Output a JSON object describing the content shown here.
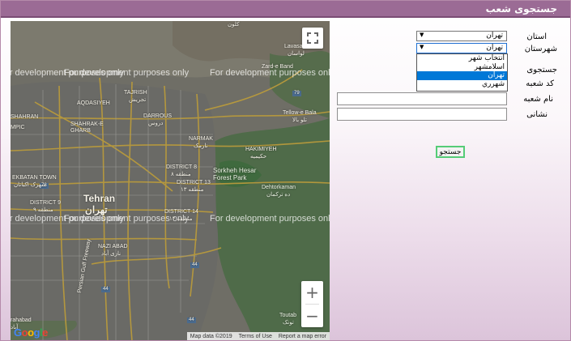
{
  "page": {
    "title": "جستجوی شعب"
  },
  "map": {
    "watermark": "For development purposes only",
    "labels": {
      "tehran_en": "Tehran",
      "tehran_fa": "تهران",
      "district8_en": "DISTRICT 8",
      "district8_fa": "منطقه ۸",
      "district13_en": "DISTRICT 13",
      "district13_fa": "منطقه ۱۳",
      "district14_en": "DISTRICT 14",
      "district14_fa": "منطقه ۱۴",
      "district9_en": "DISTRICT 9",
      "district9_fa": "منطقه ۹",
      "forest_en": "Sorkheh Hesar\nForest Park",
      "ekbatan_en": "EKBATAN TOWN",
      "ekbatan_fa": "شهرک اکباتان",
      "narmak_en": "NARMAK",
      "narmak_fa": "نارمک",
      "hakimiyeh_en": "HAKIMIYEH",
      "hakimiyeh_fa": "حکیمیه",
      "tajrish_en": "TAJRISH",
      "tajrish_fa": "تجریش",
      "darrous_en": "DARROUS",
      "darrous_fa": "دروس",
      "shahrak_en": "SHAHRAK-E\nGHARB",
      "zarde_en": "Zard-e Band",
      "lavasan_en": "Lavasan",
      "lavasan_fa": "لواسان",
      "kolun_fa": "کلون",
      "aqdasieh_en": "AQDASIYEH",
      "tellow_en": "Tellow-e Bala",
      "tellow_fa": "تلو بالا",
      "nazi_en": "NAZI ABAD",
      "nazi_fa": "نازی آباد",
      "dehtor_en": "Dehtorkaman",
      "dehtor_fa": "ده ترکمان",
      "toutab_en": "Toutab",
      "toutab_fa": "توتک",
      "shahran_en": "SHAHRAN",
      "rahabad_en": "rahabad",
      "rahabad_fa": "آباد",
      "freeway_en": "Persian Gulf Freeway",
      "azadi_en": "Azadi Fwy",
      "mpic_en": "MPIC",
      "road44": "44",
      "road79": "79",
      "road78": "78"
    },
    "fullscreen_icon": "fullscreen-icon",
    "zoom_in": "+",
    "zoom_out": "−",
    "google_letters": [
      "G",
      "o",
      "o",
      "g",
      "l",
      "e"
    ],
    "google_colors": [
      "#4285f4",
      "#ea4335",
      "#fbbc05",
      "#4285f4",
      "#34a853",
      "#ea4335"
    ],
    "attribution": {
      "map_data": "Map data ©2019",
      "terms": "Terms of Use",
      "report": "Report a map error"
    }
  },
  "form": {
    "province_label": "استان",
    "province_value": "تهران",
    "city_label": "شهرستان",
    "city_value": "تهران",
    "city_options": [
      "انتخاب شهر",
      "اسلامشهر",
      "تهران",
      "شهرري"
    ],
    "city_selected_index": 2,
    "search_text_label": "جستجوی",
    "branch_code_label": "کد شعبه",
    "branch_name_label": "نام شعبه",
    "address_label": "نشانی",
    "branch_name_value": "",
    "address_value": "",
    "search_button": "جستجو"
  },
  "colors": {
    "title_bar": "#9b6b95",
    "accent_button_border": "#55cc77",
    "dropdown_selected": "#0078d7"
  }
}
